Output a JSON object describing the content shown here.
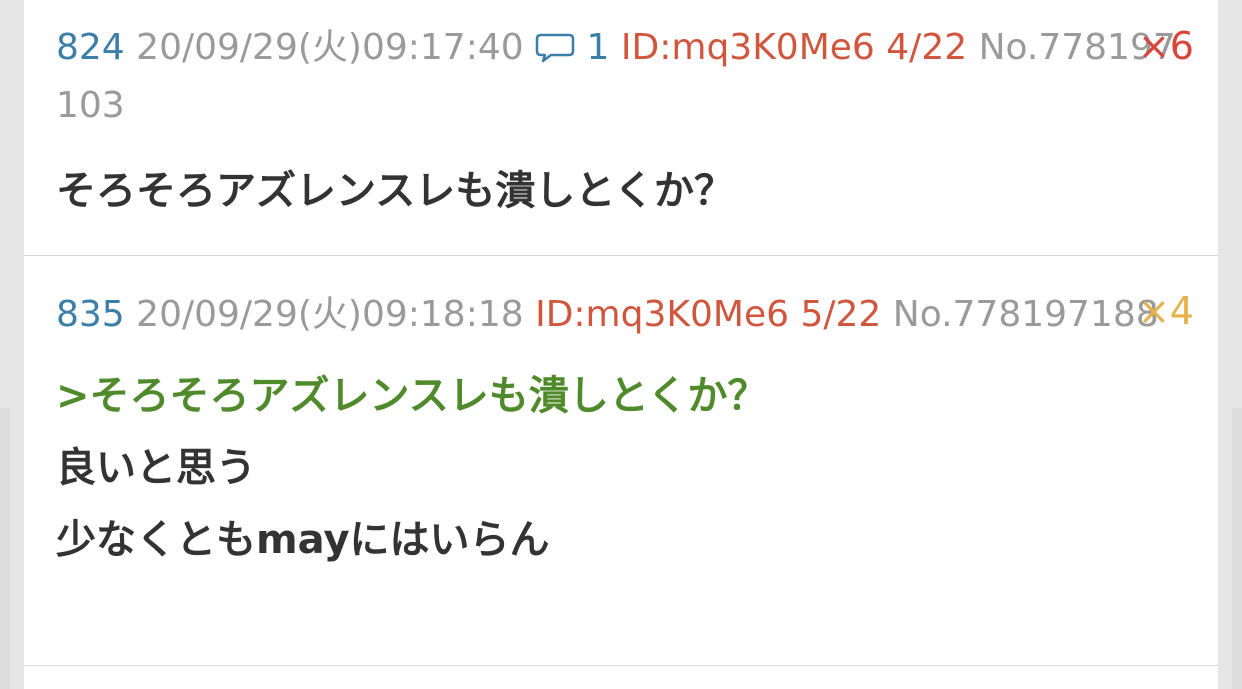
{
  "posts": [
    {
      "number": "824",
      "datetime": "20/09/29(火)09:17:40",
      "reply_count": "1",
      "id": "ID:mq3K0Me6",
      "id_count": "4/22",
      "post_no": "No.778197103",
      "badge": "×6",
      "lines": [
        "そろそろアズレンスレも潰しとくか？"
      ]
    },
    {
      "number": "835",
      "datetime": "20/09/29(火)09:18:18",
      "id": "ID:mq3K0Me6",
      "id_count": "5/22",
      "post_no": "No.778197188",
      "badge": "×4",
      "quote": ">そろそろアズレンスレも潰しとくか？",
      "lines": [
        "良いと思う",
        "少なくともmayにはいらん"
      ]
    }
  ],
  "colors": {
    "number": "#3b7ea8",
    "id": "#d0563e",
    "quote": "#4f8a2b",
    "meta": "#9a9a9a",
    "badge_red": "#d9453a",
    "badge_yellow": "#e5b24a"
  },
  "icons": {
    "reply": "speech-bubble-icon"
  }
}
